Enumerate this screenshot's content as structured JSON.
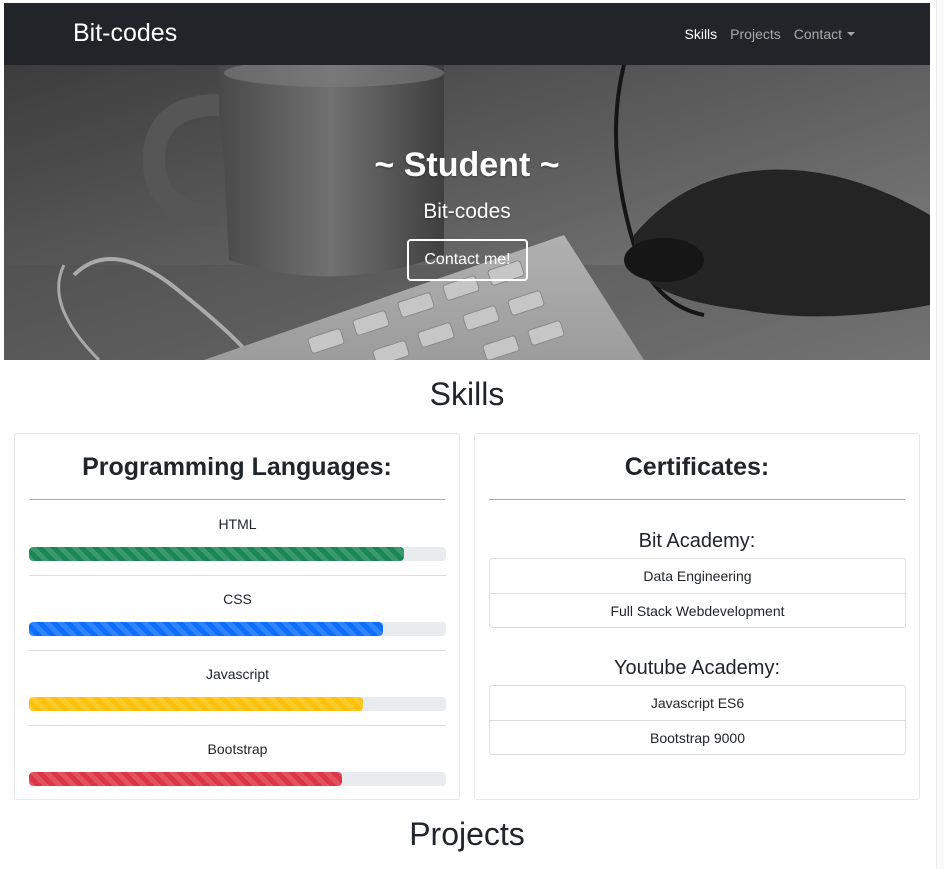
{
  "navbar": {
    "brand": "Bit-codes",
    "links": [
      {
        "label": "Skills",
        "active": true
      },
      {
        "label": "Projects",
        "active": false
      },
      {
        "label": "Contact",
        "active": false,
        "dropdown": true
      }
    ]
  },
  "hero": {
    "title": "~ Student ~",
    "subtitle": "Bit-codes",
    "button_label": "Contact me!"
  },
  "skills": {
    "heading": "Skills",
    "languages": {
      "title": "Programming Languages:",
      "items": [
        {
          "name": "HTML",
          "level": 0.9,
          "color": "#198754"
        },
        {
          "name": "CSS",
          "level": 0.85,
          "color": "#0d6efd"
        },
        {
          "name": "Javascript",
          "level": 0.8,
          "color": "#ffc107"
        },
        {
          "name": "Bootstrap",
          "level": 0.75,
          "color": "#dc3545"
        }
      ]
    },
    "certificates": {
      "title": "Certificates:",
      "groups": [
        {
          "title": "Bit Academy:",
          "items": [
            "Data Engineering",
            "Full Stack Webdevelopment"
          ]
        },
        {
          "title": "Youtube Academy:",
          "items": [
            "Javascript ES6",
            "Bootstrap 9000"
          ]
        }
      ]
    }
  },
  "projects": {
    "heading": "Projects"
  }
}
